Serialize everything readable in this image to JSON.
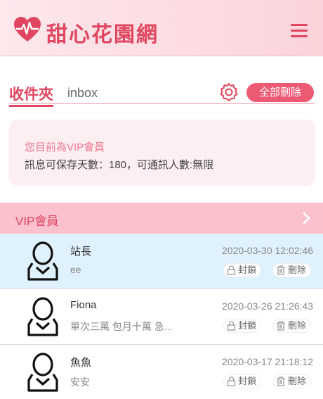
{
  "header": {
    "logo_chars": [
      "甜",
      "心",
      "花",
      "園",
      "網"
    ],
    "brand_color": "#e0465f",
    "menu_icon": "hamburger-menu-icon"
  },
  "inbox": {
    "title": "收件夾",
    "subtitle": "inbox",
    "delete_all_label": "全部刪除"
  },
  "vip_info": {
    "status": "您目前為VIP會員",
    "quota": "訊息可保存天數：180，可通訊人數:無限"
  },
  "section": {
    "title": "VIP會員"
  },
  "messages": [
    {
      "name": "站長",
      "preview": "ee",
      "time": "2020-03-30 12:02:46",
      "block_label": "封鎖",
      "delete_label": "刪除",
      "active": true
    },
    {
      "name": "Fiona",
      "preview": "單次三萬 包月十萬 急...",
      "time": "2020-03-26 21:26:43",
      "block_label": "封鎖",
      "delete_label": "刪除",
      "active": false
    },
    {
      "name": "魚魚",
      "preview": "安安",
      "time": "2020-03-17 21:18:12",
      "block_label": "封鎖",
      "delete_label": "刪除",
      "active": false
    }
  ]
}
